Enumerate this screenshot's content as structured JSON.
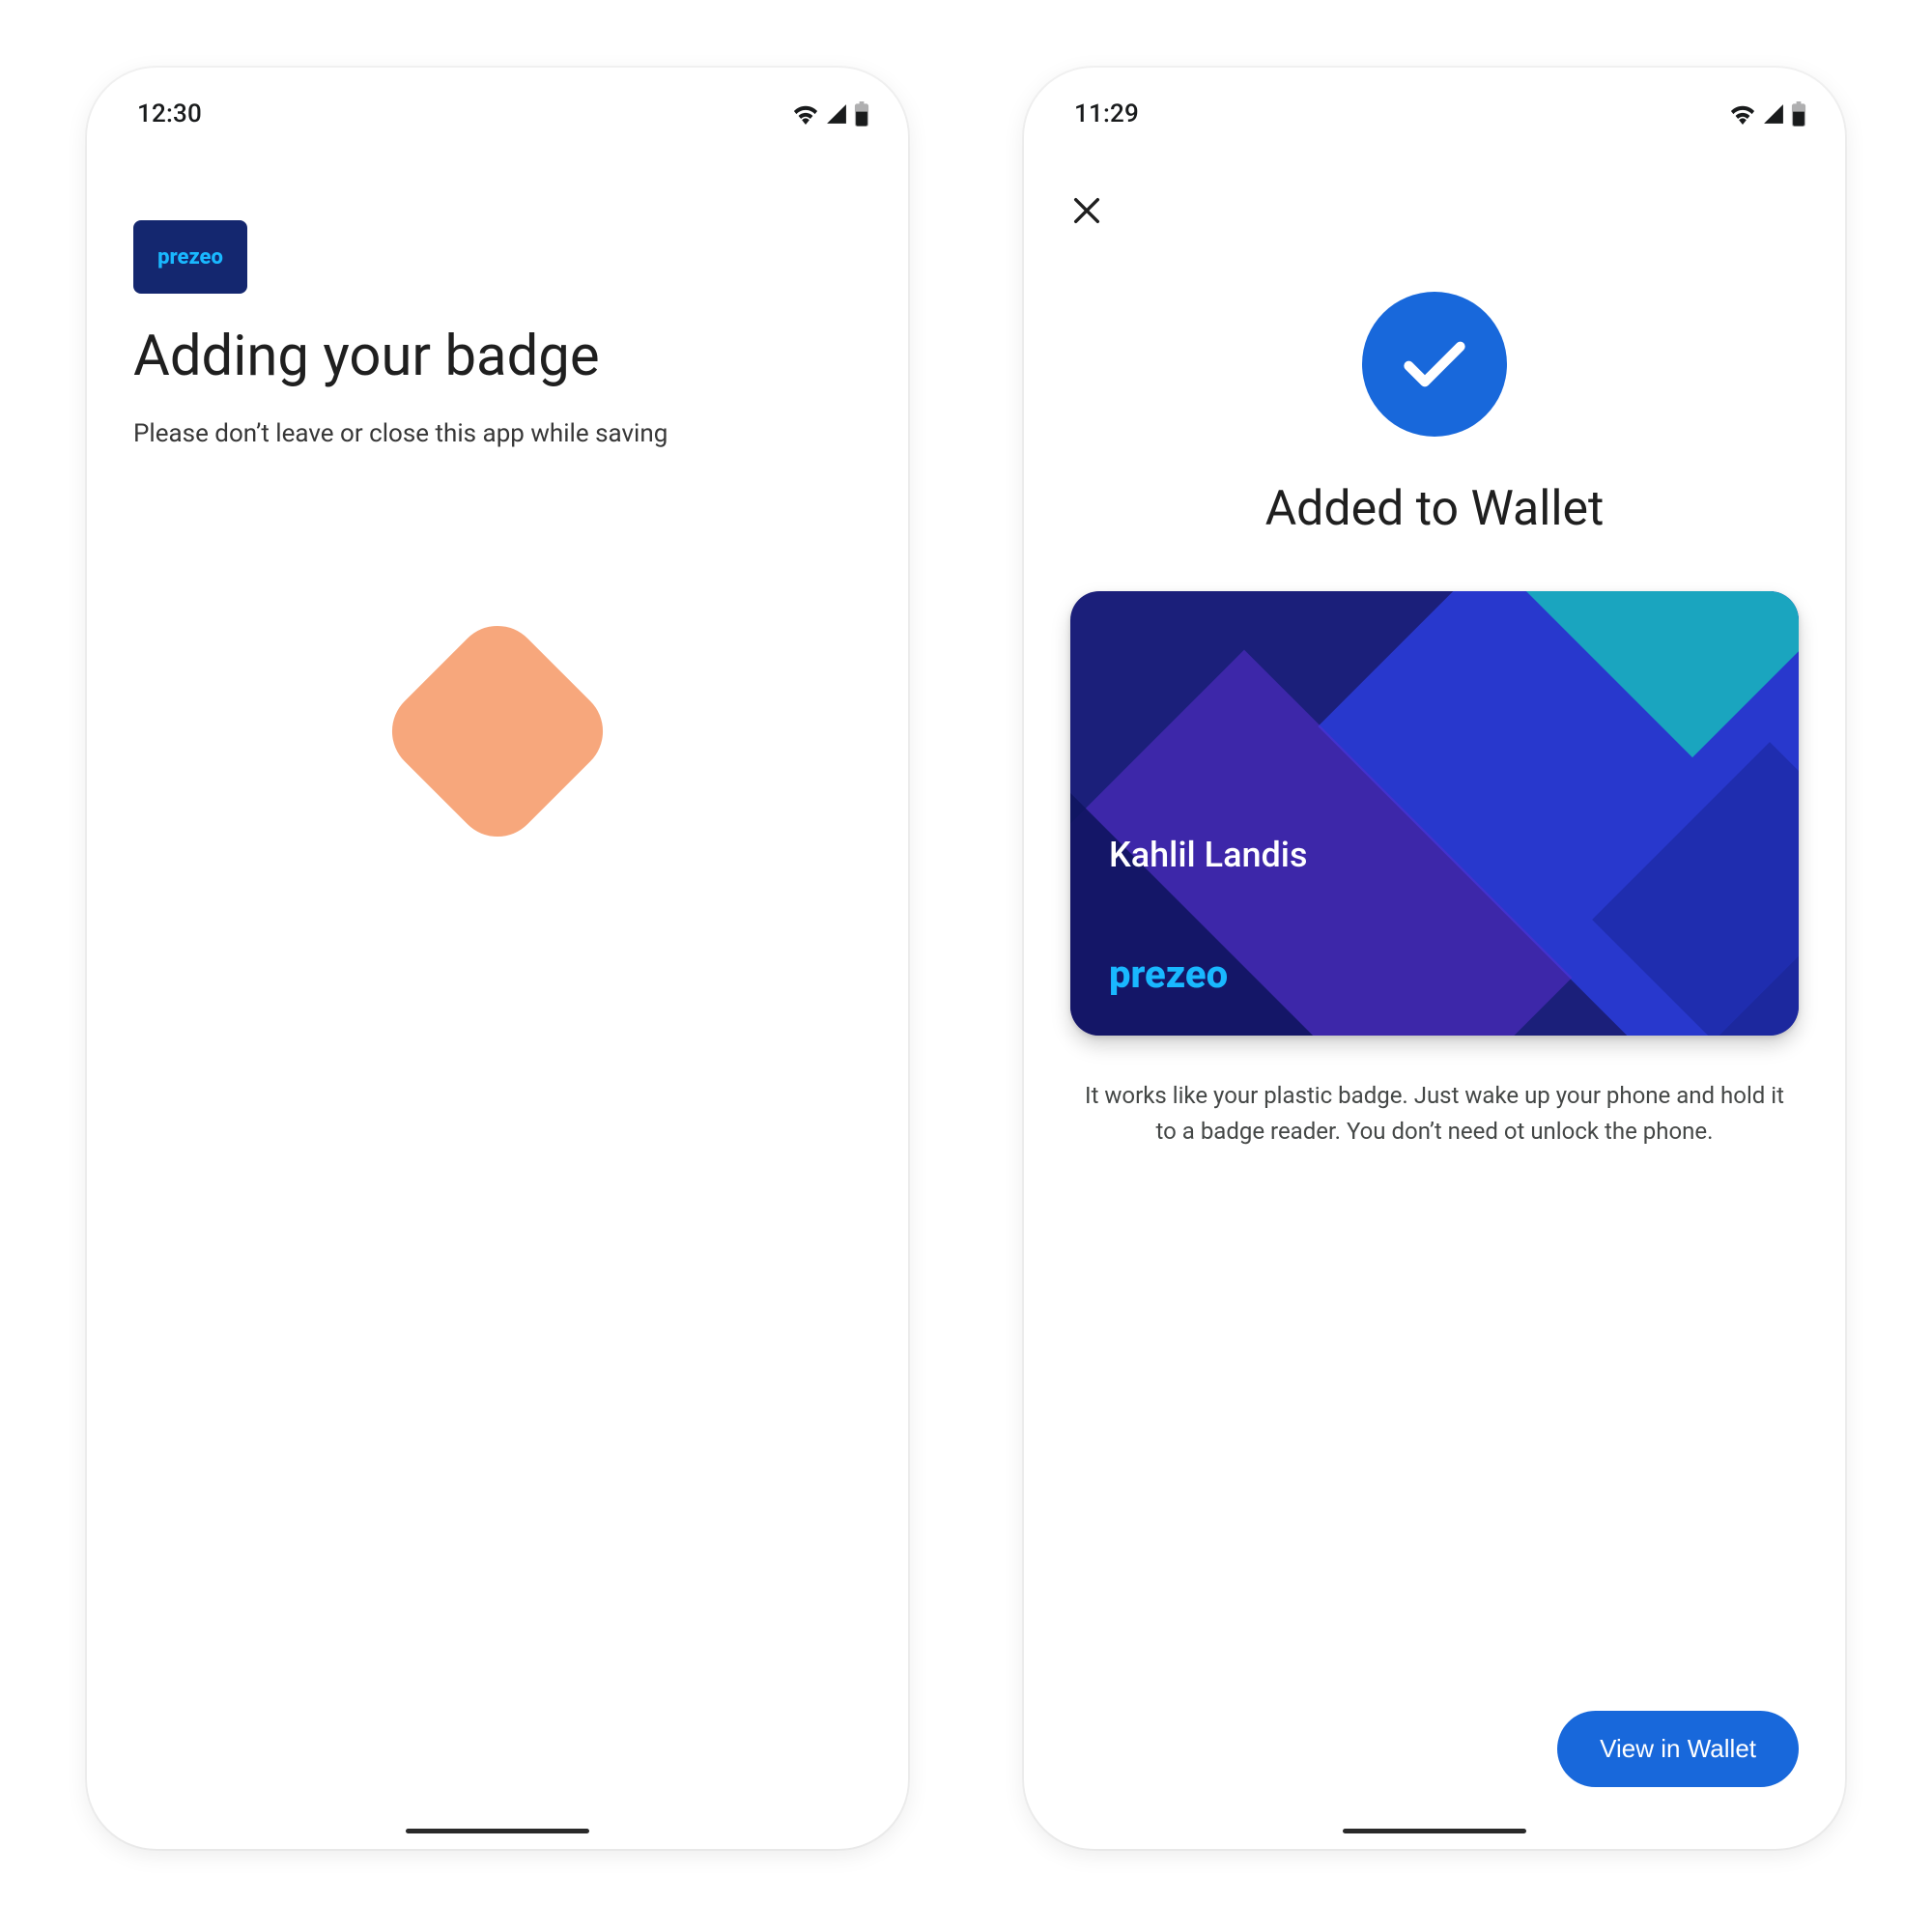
{
  "colors": {
    "accent": "#1868db",
    "brand_bg": "#14276f",
    "brand_text": "#19b8ff",
    "spinner": "#f7a77c"
  },
  "screen_left": {
    "statusbar": {
      "time": "12:30"
    },
    "brand": "prezeo",
    "title": "Adding your badge",
    "subtitle": "Please don’t leave or close this app while saving"
  },
  "screen_right": {
    "statusbar": {
      "time": "11:29"
    },
    "title": "Added to Wallet",
    "card": {
      "holder_name": "Kahlil Landis",
      "brand": "prezeo"
    },
    "info": "It works like your plastic badge. Just wake up your phone and hold it to a badge reader. You don’t need ot unlock the phone.",
    "cta_label": "View in Wallet"
  }
}
